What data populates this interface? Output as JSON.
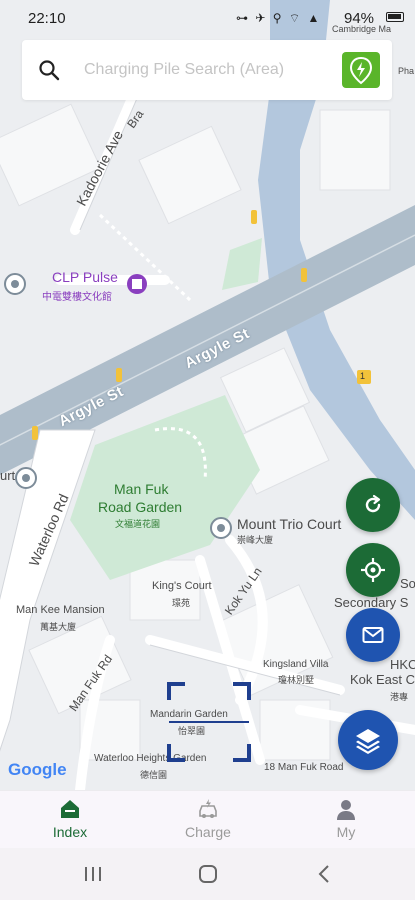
{
  "status_bar": {
    "time": "22:10",
    "indicators": "⊶ ✈ ⚲ ⌔ ▲",
    "battery": "94%"
  },
  "search": {
    "placeholder": "Charging Pile Search (Area)",
    "value": ""
  },
  "map": {
    "labels": {
      "cambridge": "Cambridge Ma",
      "phase": "Pha",
      "braemar": "Bra",
      "kadoorie": "Kadoorie Ave",
      "clp_en": "CLP Pulse",
      "clp_zh": "中電雙樓文化館",
      "argyle_1": "Argyle St",
      "argyle_2": "Argyle St",
      "court_left": "urt",
      "waterloo": "Waterloo Rd",
      "man_fuk_en": "Man Fuk",
      "man_fuk_en2": "Road Garden",
      "man_fuk_zh": "文福道花園",
      "mount_trio_en": "Mount Trio Court",
      "mount_trio_zh": "崇峰大廈",
      "kings_court_en": "King's Court",
      "kings_court_zh": "璟苑",
      "kok_yu": "Kok Yu Ln",
      "man_kee_en": "Man Kee Mansion",
      "man_kee_zh": "萬基大廈",
      "secondary": "Secondary S",
      "so": "So",
      "kingsland_en": "Kingsland Villa",
      "kingsland_zh": "瓊林別墅",
      "hkc": "HKC",
      "kok_east": "Kok East C",
      "kok_east_zh": "港專",
      "man_fuk_rd": "Man Fuk Rd",
      "mandarin_en": "Mandarin Garden",
      "mandarin_zh": "怡翠園",
      "waterloo_heights_en": "Waterloo Heights Garden",
      "waterloo_heights_zh": "德信園",
      "man_fuk_18": "18 Man Fuk Road",
      "route_badge": "1"
    },
    "attribution": "Google"
  },
  "tabs": [
    {
      "label": "Index",
      "active": true
    },
    {
      "label": "Charge",
      "active": false
    },
    {
      "label": "My",
      "active": false
    }
  ],
  "colors": {
    "primary_green": "#1c6b36",
    "accent_blue": "#1f54b0",
    "pile_green": "#5ab52a"
  }
}
